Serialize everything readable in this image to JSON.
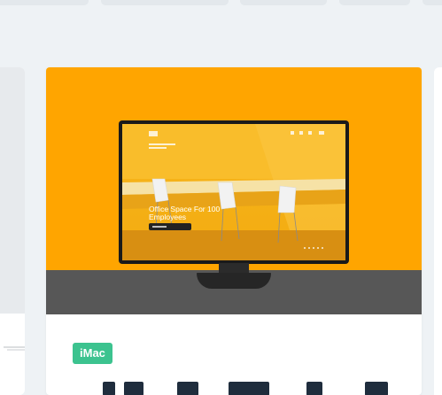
{
  "card": {
    "badge_label": "iMac",
    "screen": {
      "headline_line1": "Office Space For 100",
      "headline_line2": "Employees"
    }
  },
  "colors": {
    "page_background": "#eef2f5",
    "card_image_background": "#ffa500",
    "badge": "#3cc38f"
  }
}
